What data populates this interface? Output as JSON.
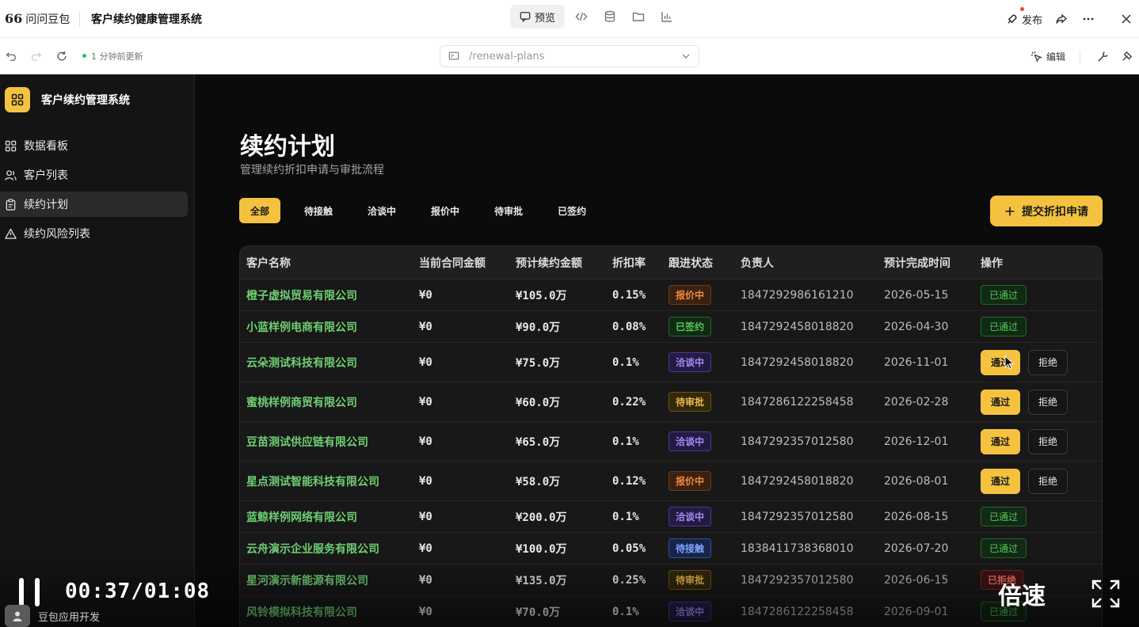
{
  "topbar": {
    "brand_glyph": "66",
    "brand": "问问豆包",
    "project_title": "客户续约健康管理系统",
    "preview_label": "预览",
    "publish_label": "发布"
  },
  "subbar": {
    "updated_text": "1 分钟前更新",
    "url_path": "/renewal-plans",
    "edit_label": "编辑"
  },
  "sidebar": {
    "app_name": "客户续约管理系统",
    "items": [
      {
        "label": "数据看板",
        "icon": "grid-icon"
      },
      {
        "label": "客户列表",
        "icon": "users-icon"
      },
      {
        "label": "续约计划",
        "icon": "clipboard-icon",
        "active": true
      },
      {
        "label": "续约风险列表",
        "icon": "alert-triangle-icon"
      }
    ]
  },
  "main": {
    "title": "续约计划",
    "subtitle": "管理续约折扣申请与审批流程",
    "filters": [
      "全部",
      "待接触",
      "洽谈中",
      "报价中",
      "待审批",
      "已签约"
    ],
    "active_filter": "全部",
    "submit_label": "提交折扣申请",
    "table": {
      "headers": [
        "客户名称",
        "当前合同金额",
        "预计续约金额",
        "折扣率",
        "跟进状态",
        "负责人",
        "预计完成时间",
        "操作"
      ],
      "approve_label": "通过",
      "reject_label": "拒绝",
      "rows": [
        {
          "company": "橙子虚拟贸易有限公司",
          "current": "¥0",
          "expected": "¥105.0万",
          "discount": "0.15%",
          "status": "报价中",
          "status_type": "quote",
          "owner": "1847292986161210",
          "date": "2026-05-15",
          "action": "已通过"
        },
        {
          "company": "小蓝样例电商有限公司",
          "current": "¥0",
          "expected": "¥90.0万",
          "discount": "0.08%",
          "status": "已签约",
          "status_type": "signed",
          "owner": "1847292458018820",
          "date": "2026-04-30",
          "action": "已通过"
        },
        {
          "company": "云朵测试科技有限公司",
          "current": "¥0",
          "expected": "¥75.0万",
          "discount": "0.1%",
          "status": "洽谈中",
          "status_type": "negotiate",
          "owner": "1847292458018820",
          "date": "2026-11-01",
          "action": "buttons"
        },
        {
          "company": "蜜桃样例商贸有限公司",
          "current": "¥0",
          "expected": "¥60.0万",
          "discount": "0.22%",
          "status": "待审批",
          "status_type": "approve",
          "owner": "1847286122258458",
          "date": "2026-02-28",
          "action": "buttons"
        },
        {
          "company": "豆苗测试供应链有限公司",
          "current": "¥0",
          "expected": "¥65.0万",
          "discount": "0.1%",
          "status": "洽谈中",
          "status_type": "negotiate",
          "owner": "1847292357012580",
          "date": "2026-12-01",
          "action": "buttons"
        },
        {
          "company": "星点测试智能科技有限公司",
          "current": "¥0",
          "expected": "¥58.0万",
          "discount": "0.12%",
          "status": "报价中",
          "status_type": "quote",
          "owner": "1847292458018820",
          "date": "2026-08-01",
          "action": "buttons"
        },
        {
          "company": "蓝鲸样例网络有限公司",
          "current": "¥0",
          "expected": "¥200.0万",
          "discount": "0.1%",
          "status": "洽谈中",
          "status_type": "negotiate",
          "owner": "1847292357012580",
          "date": "2026-08-15",
          "action": "已通过"
        },
        {
          "company": "云舟演示企业服务有限公司",
          "current": "¥0",
          "expected": "¥100.0万",
          "discount": "0.05%",
          "status": "待接触",
          "status_type": "contact",
          "owner": "1838411738368010",
          "date": "2026-07-20",
          "action": "已通过"
        },
        {
          "company": "星河演示新能源有限公司",
          "current": "¥0",
          "expected": "¥135.0万",
          "discount": "0.25%",
          "status": "待审批",
          "status_type": "approve",
          "owner": "1847292357012580",
          "date": "2026-06-15",
          "action": "已拒绝"
        },
        {
          "company": "风铃模拟科技有限公司",
          "current": "¥0",
          "expected": "¥70.0万",
          "discount": "0.1%",
          "status": "洽谈中",
          "status_type": "negotiate",
          "owner": "1847286122258458",
          "date": "2026-09-01",
          "action": "已通过"
        }
      ]
    }
  },
  "video": {
    "timecode": "00:37/01:08",
    "speed_label": "倍速",
    "dock_label": "豆包应用开发"
  },
  "colors": {
    "accent": "#f5c240",
    "company_green": "#6fcf73",
    "bg_dark": "#0b0b0b"
  }
}
